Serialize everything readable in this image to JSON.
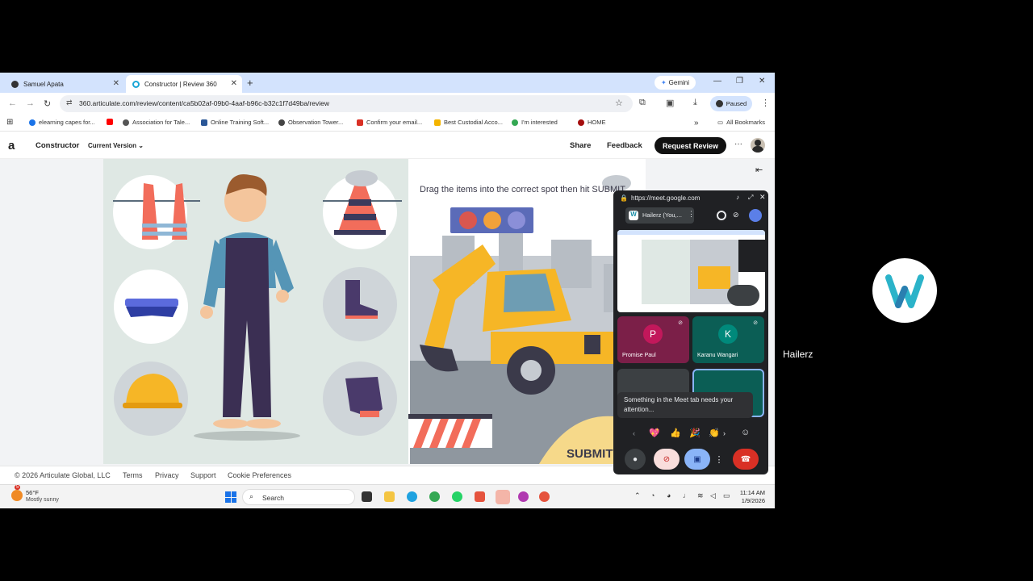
{
  "browser": {
    "tabs": [
      {
        "title": "Samuel Apata",
        "active": false
      },
      {
        "title": "Constructor | Review 360",
        "active": true
      }
    ],
    "gemini_label": "Gemini",
    "url": "360.articulate.com/review/content/ca5b02af-09b0-4aaf-b96c-b32c1f7d49ba/review",
    "profile_status": "Paused",
    "bookmarks": [
      {
        "label": "elearning capes for...",
        "color": "#1a73e8"
      },
      {
        "label": "",
        "color": "#ff0000"
      },
      {
        "label": "Association for Tale...",
        "color": "#555555"
      },
      {
        "label": "Online Training Soft...",
        "color": "#2b5797"
      },
      {
        "label": "Observation Tower...",
        "color": "#444444"
      },
      {
        "label": "Confirm your email...",
        "color": "#d93025"
      },
      {
        "label": "Best Custodial Acco...",
        "color": "#f4b400"
      },
      {
        "label": "I'm interested",
        "color": "#34a853"
      },
      {
        "label": "HOME",
        "color": "#a50e0e"
      }
    ],
    "all_bookmarks": "All Bookmarks"
  },
  "app": {
    "logo": "a",
    "name": "Constructor",
    "version": "Current Version",
    "share": "Share",
    "feedback": "Feedback",
    "request_review": "Request Review",
    "more": "···"
  },
  "slide": {
    "instruction": "Drag the items into the correct spot then hit SUBMIT",
    "submit": "SUBMIT",
    "dot_colors": [
      "#d9574f",
      "#f2a13a",
      "#8b8fd8"
    ]
  },
  "footer": {
    "copyright": "© 2026 Articulate Global, LLC",
    "links": [
      "Terms",
      "Privacy",
      "Support",
      "Cookie Preferences"
    ]
  },
  "taskbar": {
    "weather_badge": "5",
    "temp": "56°F",
    "weather": "Mostly sunny",
    "search": "Search",
    "time": "11:14 AM",
    "date": "1/9/2026"
  },
  "meet": {
    "url": "https://meet.google.com",
    "presenter_chip": "Hailerz (You,...",
    "participants": [
      {
        "initial": "P",
        "name": "Promise Paul",
        "color": "#c2185b",
        "bg": "#7b1f48"
      },
      {
        "initial": "K",
        "name": "Karanu Wangari",
        "color": "#00897b",
        "bg": "#0b5e55"
      }
    ],
    "toast": "Something in the Meet tab needs your attention...",
    "reactions": [
      "💖",
      "👍",
      "🎉",
      "👏"
    ]
  },
  "right_panel": {
    "name": "Hailerz"
  }
}
